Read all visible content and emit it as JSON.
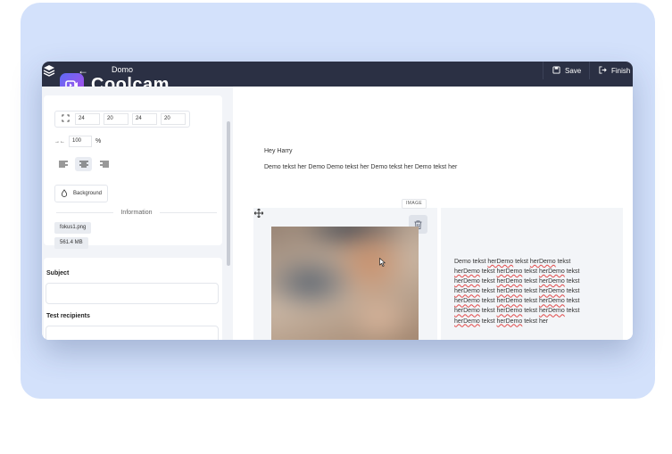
{
  "topbar": {
    "back_glyph": "←",
    "title": "Domo",
    "save_label": "Save",
    "finish_label": "Finish i",
    "icons": [
      "layers-icon",
      "back-arrow-icon",
      "save-icon",
      "exit-icon"
    ]
  },
  "brand": {
    "name": "Coolcam"
  },
  "sidebar": {
    "padding_values": [
      "24",
      "20",
      "24",
      "20"
    ],
    "width_value": "100",
    "width_unit": "%",
    "width_glyph": "→←",
    "alignments": [
      "align-left",
      "align-center",
      "align-right"
    ],
    "active_alignment": "align-center",
    "background_label": "Background",
    "info_heading": "Information",
    "file_name": "fokus1.png",
    "file_size": "561.4 MB",
    "subject_label": "Subject",
    "subject_value": "",
    "test_recipients_label": "Test recipients",
    "test_recipients_value": ""
  },
  "email": {
    "greeting": "Hey Harry",
    "intro": "Demo tekst her Demo Demo tekst her Demo tekst her Demo tekst her",
    "image_tag": "IMAGE",
    "paragraph": [
      [
        "Demo tekst ",
        "herDemo",
        " tekst ",
        "herDemo",
        " tekst"
      ],
      [
        "herDemo",
        " tekst ",
        "herDemo",
        " tekst ",
        "herDemo",
        " tekst"
      ],
      [
        "herDemo",
        " tekst ",
        "herDemo",
        " tekst ",
        "herDemo",
        " tekst"
      ],
      [
        "herDemo",
        " tekst ",
        "herDemo",
        " tekst ",
        "herDemo",
        " tekst"
      ],
      [
        "herDemo",
        " tekst ",
        "herDemo",
        " tekst ",
        "herDemo",
        " tekst"
      ],
      [
        "herDemo",
        " tekst ",
        "herDemo",
        " tekst ",
        "herDemo",
        " tekst"
      ],
      [
        "herDemo",
        " tekst ",
        "herDemo",
        " tekst her"
      ]
    ]
  },
  "colors": {
    "topbar_bg": "#2b3044",
    "backdrop": "#d3e1fb",
    "brand_gradient_start": "#5d6bf5",
    "brand_gradient_end": "#b24be8",
    "spellcheck_underline": "#e24a4a"
  }
}
